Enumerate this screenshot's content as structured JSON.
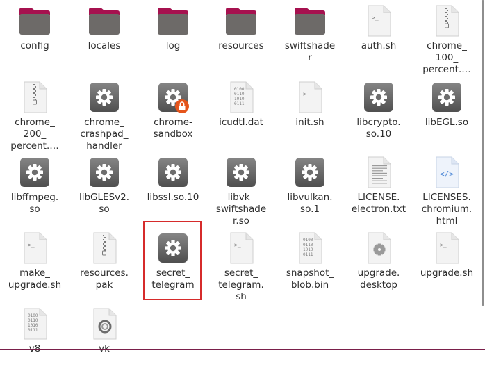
{
  "files": [
    {
      "name": "config",
      "icon": "folder-icon"
    },
    {
      "name": "locales",
      "icon": "folder-icon"
    },
    {
      "name": "log",
      "icon": "folder-icon"
    },
    {
      "name": "resources",
      "icon": "folder-icon"
    },
    {
      "name": "swiftshader",
      "label": "swiftshade\nr",
      "icon": "folder-icon"
    },
    {
      "name": "auth.sh",
      "icon": "script-file-icon"
    },
    {
      "name": "chrome_100_percent.pak",
      "label": "chrome_\n100_\npercent.…",
      "icon": "archive-file-icon"
    },
    {
      "name": "chrome_200_percent.pak",
      "label": "chrome_\n200_\npercent.…",
      "icon": "archive-file-icon"
    },
    {
      "name": "chrome_crashpad_handler",
      "label": "chrome_\ncrashpad_\nhandler",
      "icon": "executable-icon"
    },
    {
      "name": "chrome-sandbox",
      "label": "chrome-\nsandbox",
      "icon": "executable-icon",
      "locked": true
    },
    {
      "name": "icudtl.dat",
      "icon": "binary-file-icon"
    },
    {
      "name": "init.sh",
      "icon": "script-file-icon"
    },
    {
      "name": "libcrypto.so.10",
      "label": "libcrypto.\nso.10",
      "icon": "executable-icon"
    },
    {
      "name": "libEGL.so",
      "icon": "executable-icon"
    },
    {
      "name": "libffmpeg.so",
      "label": "libffmpeg.\nso",
      "icon": "executable-icon"
    },
    {
      "name": "libGLESv2.so",
      "label": "libGLESv2.\nso",
      "icon": "executable-icon"
    },
    {
      "name": "libssl.so.10",
      "icon": "executable-icon"
    },
    {
      "name": "libvk_swiftshader.so",
      "label": "libvk_\nswiftshade\nr.so",
      "icon": "executable-icon"
    },
    {
      "name": "libvulkan.so.1",
      "label": "libvulkan.\nso.1",
      "icon": "executable-icon"
    },
    {
      "name": "LICENSE.electron.txt",
      "label": "LICENSE.\nelectron.txt",
      "icon": "text-file-icon"
    },
    {
      "name": "LICENSES.chromium.html",
      "label": "LICENSES.\nchromium.\nhtml",
      "icon": "html-file-icon"
    },
    {
      "name": "make_upgrade.sh",
      "label": "make_\nupgrade.sh",
      "icon": "script-file-icon"
    },
    {
      "name": "resources.pak",
      "label": "resources.\npak",
      "icon": "archive-file-icon"
    },
    {
      "name": "secret_telegram",
      "label": "secret_\ntelegram",
      "icon": "executable-icon",
      "selected": true
    },
    {
      "name": "secret_telegram.sh",
      "label": "secret_\ntelegram.\nsh",
      "icon": "script-file-icon"
    },
    {
      "name": "snapshot_blob.bin",
      "label": "snapshot_\nblob.bin",
      "icon": "binary-file-icon"
    },
    {
      "name": "upgrade.desktop",
      "label": "upgrade.\ndesktop",
      "icon": "desktop-file-icon"
    },
    {
      "name": "upgrade.sh",
      "icon": "script-file-icon"
    },
    {
      "name": "v8",
      "icon": "binary-file-icon"
    },
    {
      "name": "vk",
      "icon": "generic-file-icon"
    }
  ],
  "colors": {
    "folder_body": "#6d6a68",
    "folder_tab": "#a6114f",
    "executable_top": "#858585",
    "executable_bottom": "#4f4f4f",
    "page_fill": "#f3f3f3",
    "page_edge": "#cfcfcf",
    "lock_badge": "#e5541b",
    "selection_border": "#d62b2b",
    "label_text": "#2e2e2e"
  }
}
